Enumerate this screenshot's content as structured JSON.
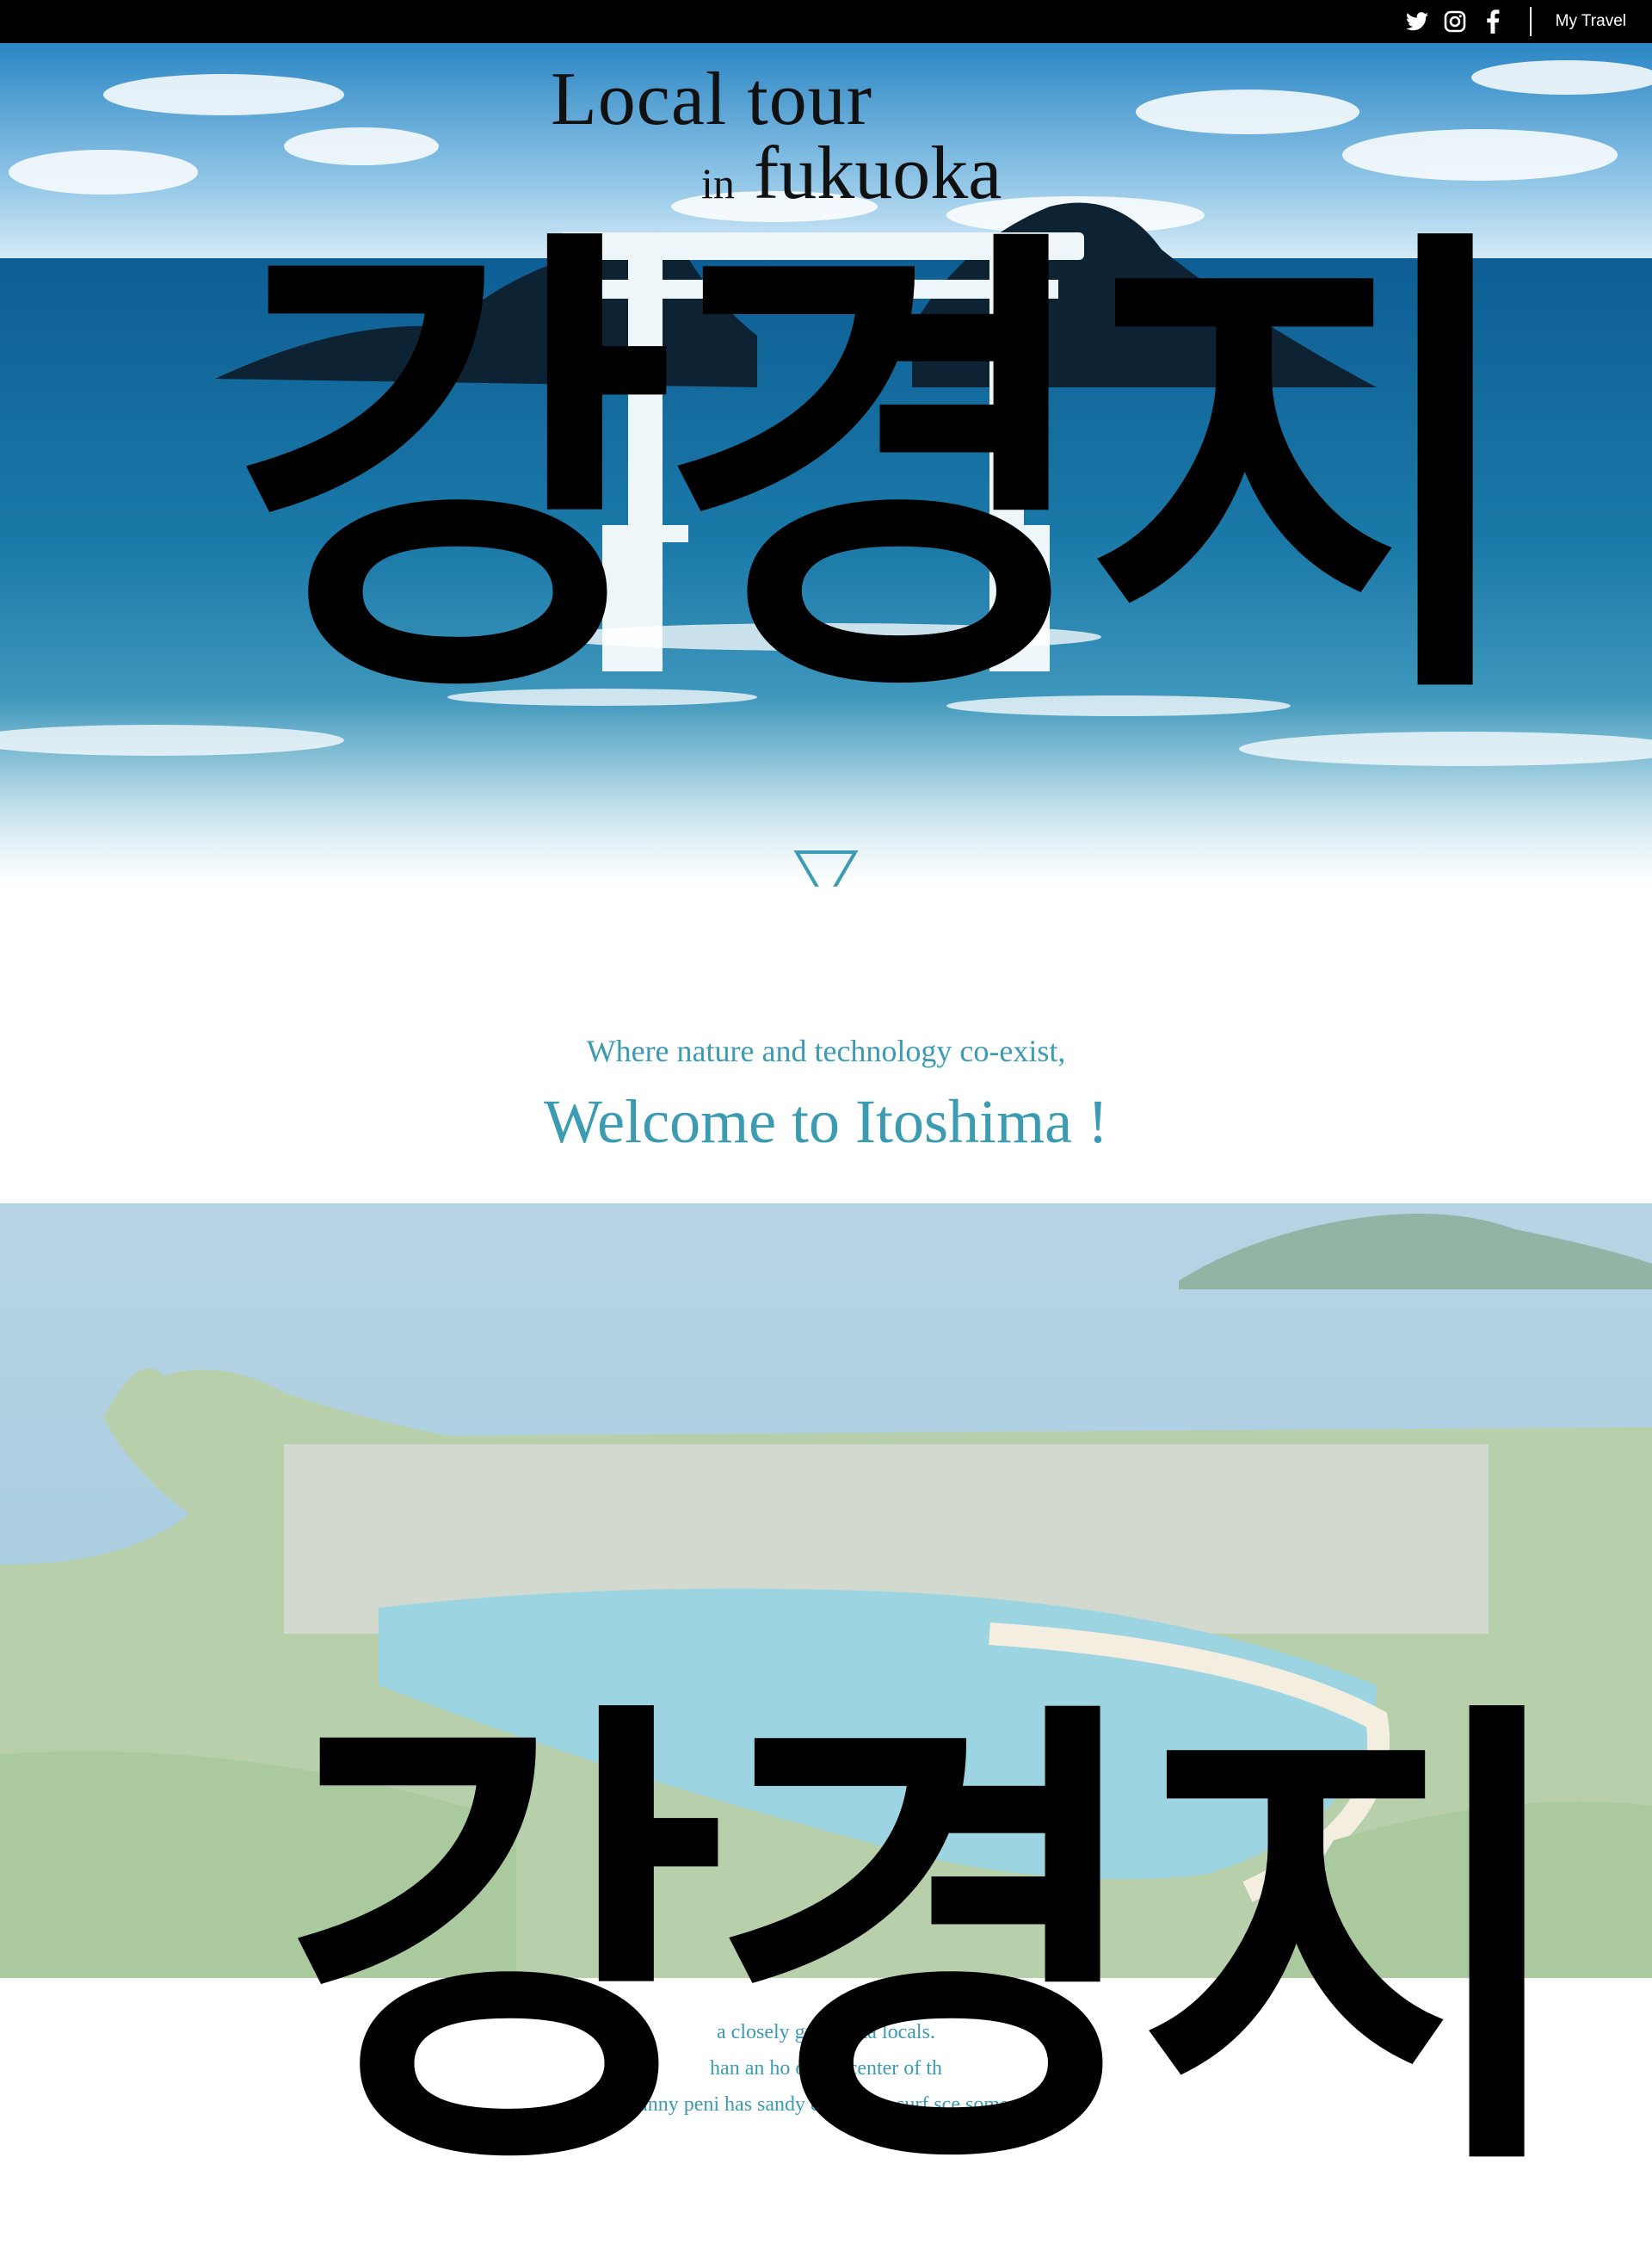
{
  "topbar": {
    "social": [
      "twitter-icon",
      "instagram-icon",
      "facebook-icon"
    ],
    "my_travel": "My Travel"
  },
  "hero": {
    "title_line1": "Local tour",
    "title_in": "in",
    "title_place": "fukuoka",
    "overlay_text": "강경지"
  },
  "intro": {
    "subtitle": "Where nature and technology co-exist,",
    "title": "Welcome to Itoshima !"
  },
  "description": {
    "lines": [
      "a closely guard                     oka locals.",
      "han an ho      of the center of th",
      "this sunny peni       has sandy        es, a busy surf sce       some epi      s."
    ]
  },
  "colors": {
    "accent": "#3a9bb3",
    "topbar": "#000000"
  }
}
